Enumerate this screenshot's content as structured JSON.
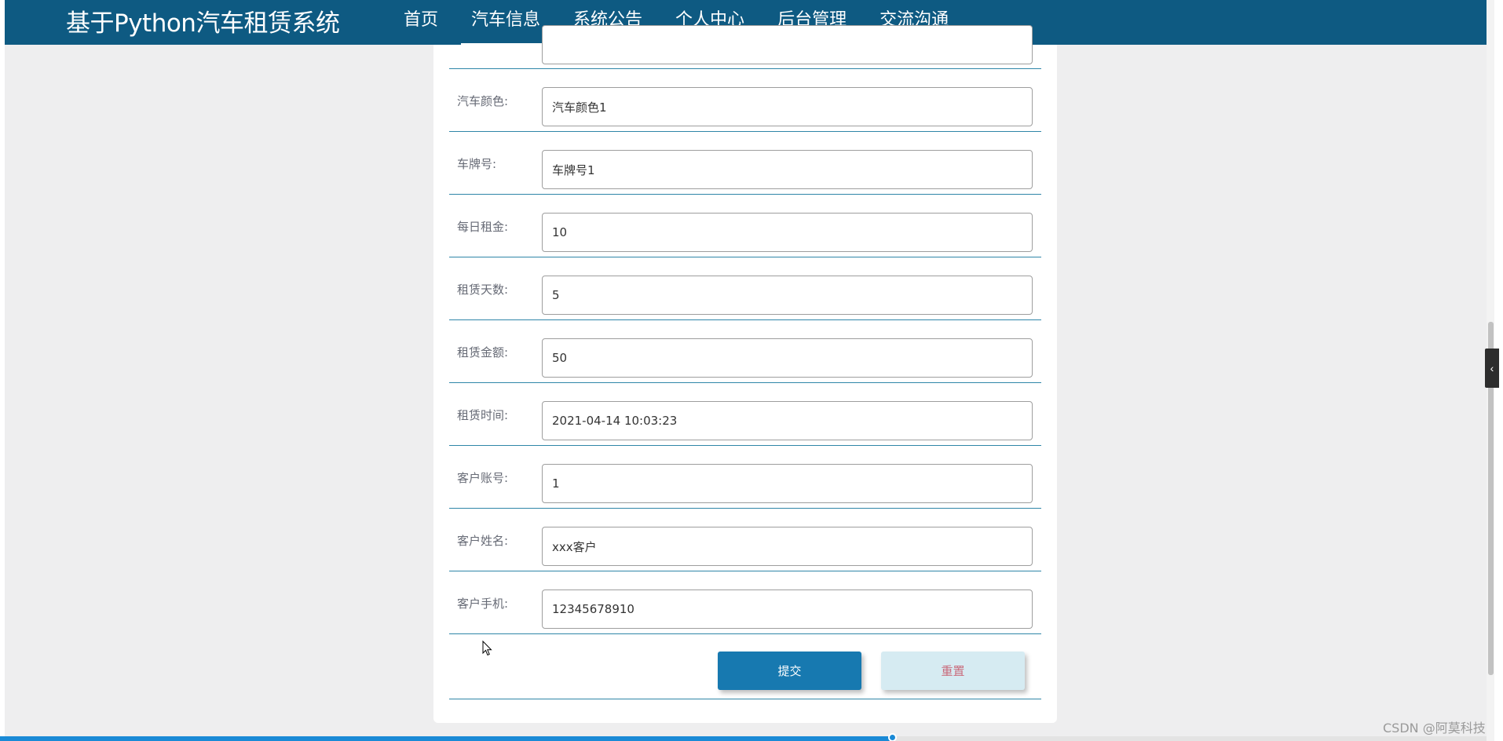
{
  "header": {
    "brand": "基于Python汽车租赁系统",
    "nav": [
      {
        "label": "首页"
      },
      {
        "label": "汽车信息"
      },
      {
        "label": "系统公告"
      },
      {
        "label": "个人中心"
      },
      {
        "label": "后台管理"
      },
      {
        "label": "交流沟通"
      }
    ],
    "active_index": 1
  },
  "form": {
    "fields": [
      {
        "label": "汽车颜色:",
        "value": "汽车颜色1"
      },
      {
        "label": "车牌号:",
        "value": "车牌号1"
      },
      {
        "label": "每日租金:",
        "value": "10"
      },
      {
        "label": "租赁天数:",
        "value": "5"
      },
      {
        "label": "租赁金额:",
        "value": "50"
      },
      {
        "label": "租赁时间:",
        "value": "2021-04-14 10:03:23"
      },
      {
        "label": "客户账号:",
        "value": "1"
      },
      {
        "label": "客户姓名:",
        "value": "xxx客户"
      },
      {
        "label": "客户手机:",
        "value": "12345678910"
      }
    ],
    "submit_label": "提交",
    "reset_label": "重置"
  },
  "side_tab_icon": "chevron-left-icon",
  "watermark": "CSDN @阿莫科技",
  "colors": {
    "header_bg": "#0e5a82",
    "submit_bg": "#1779b0",
    "reset_bg": "#d6ebf2",
    "row_border": "#2f86a8"
  }
}
